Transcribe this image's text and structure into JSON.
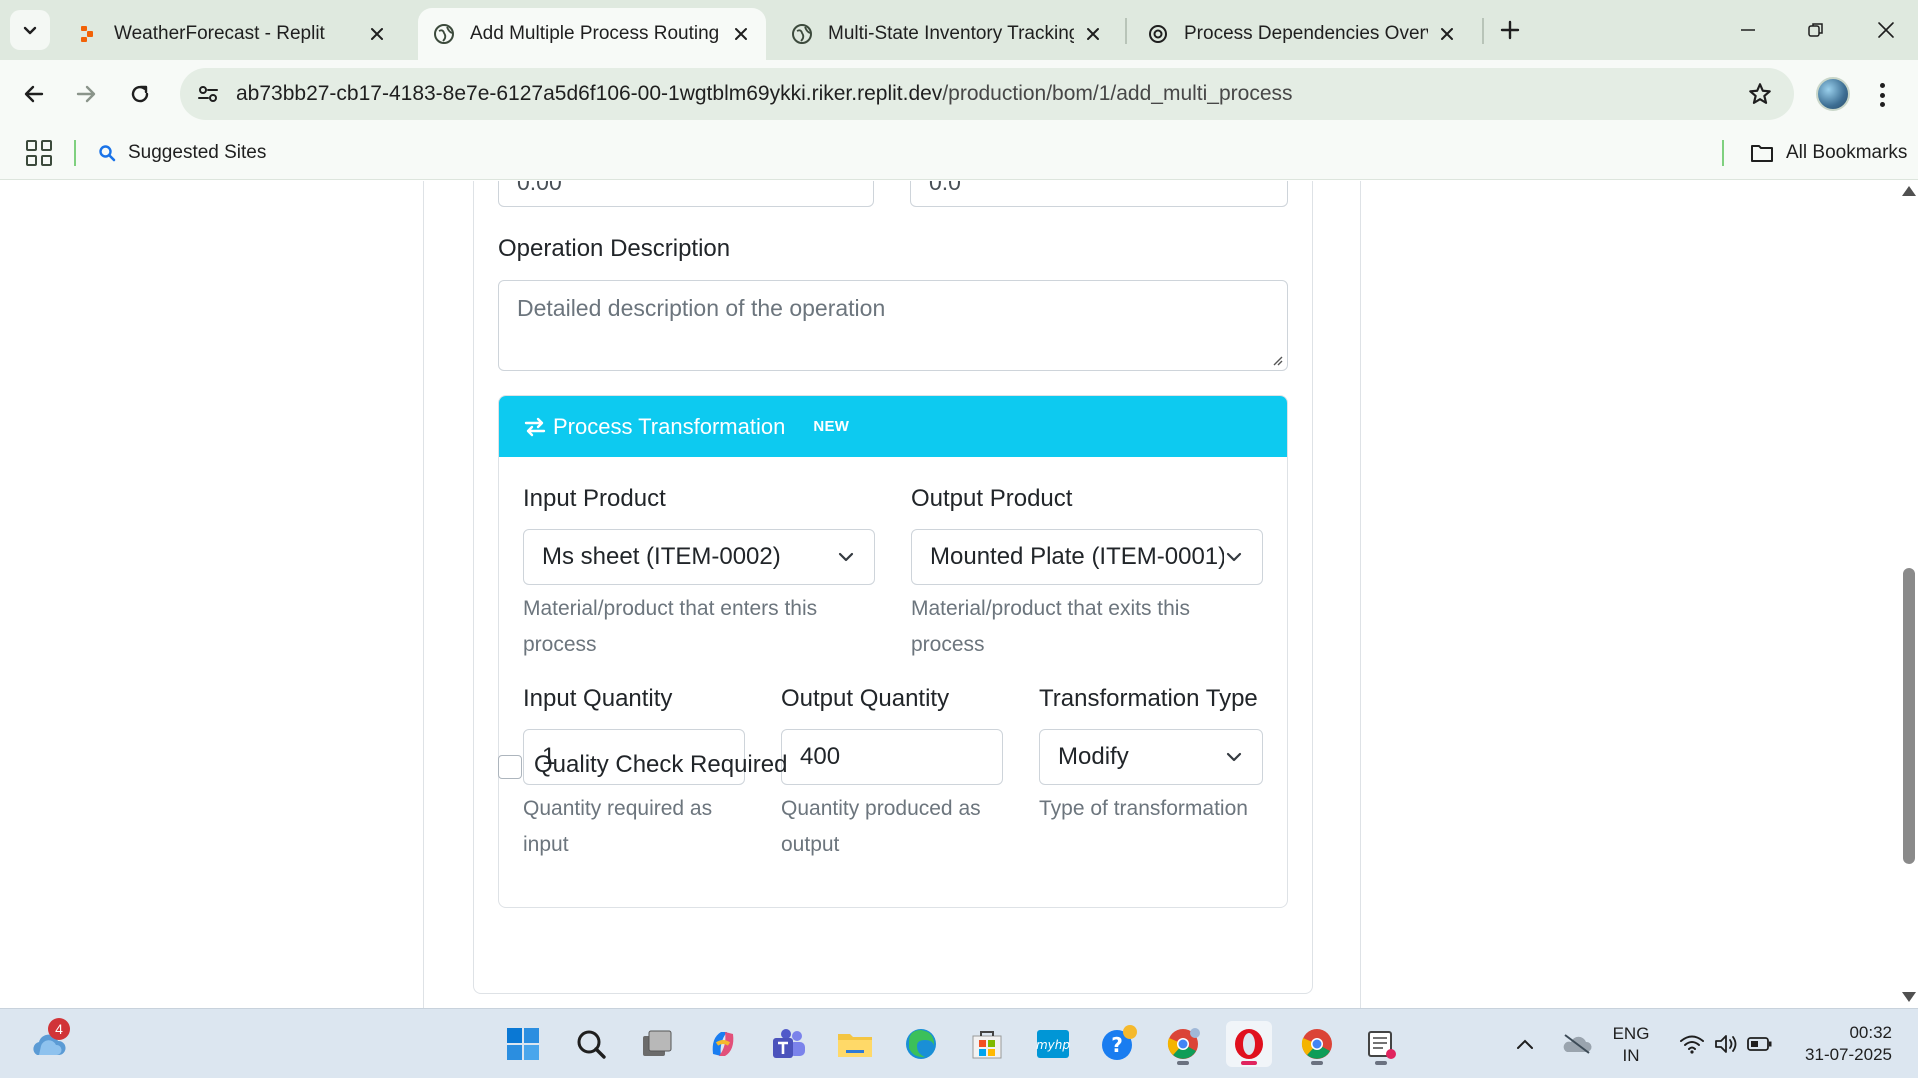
{
  "browser": {
    "tabs": [
      {
        "title": "WeatherForecast - Replit",
        "icon": "replit-icon"
      },
      {
        "title": "Add Multiple Process Routing -",
        "icon": "globe-icon",
        "active": true
      },
      {
        "title": "Multi-State Inventory Tracking",
        "icon": "globe-icon"
      },
      {
        "title": "Process Dependencies Overview",
        "icon": "openai-icon"
      }
    ],
    "url_host": "ab73bb27-cb17-4183-8e7e-6127a5d6f106-00-1wgtblm69ykki.riker.replit.dev",
    "url_path": "/production/bom/1/add_multi_process",
    "bookmarks": {
      "suggested": "Suggested Sites",
      "all": "All Bookmarks"
    }
  },
  "form": {
    "prev_field_left_value": "0.00",
    "prev_field_right_value": "0.0",
    "operation_description": {
      "label": "Operation Description",
      "placeholder": "Detailed description of the operation"
    },
    "process_transformation": {
      "title": "Process Transformation",
      "badge": "NEW",
      "accent_color": "#0dcaf0",
      "input_product": {
        "label": "Input Product",
        "value": "Ms sheet (ITEM-0002)",
        "help": [
          "Material/product that enters this",
          "process"
        ]
      },
      "output_product": {
        "label": "Output Product",
        "value": "Mounted Plate (ITEM-0001)",
        "help": [
          "Material/product that exits this",
          "process"
        ]
      },
      "input_quantity": {
        "label": "Input Quantity",
        "value": "1",
        "help": [
          "Quantity required as",
          "input"
        ]
      },
      "output_quantity": {
        "label": "Output Quantity",
        "value": "400",
        "help": [
          "Quantity produced as",
          "output"
        ]
      },
      "transformation_type": {
        "label": "Transformation Type",
        "value": "Modify",
        "help": [
          "Type of transformation"
        ]
      }
    },
    "quality_check": {
      "label": "Quality Check Required",
      "checked": false
    }
  },
  "taskbar": {
    "weather_badge": "4",
    "lang_line1": "ENG",
    "lang_line2": "IN",
    "time": "00:32",
    "date": "31-07-2025"
  }
}
